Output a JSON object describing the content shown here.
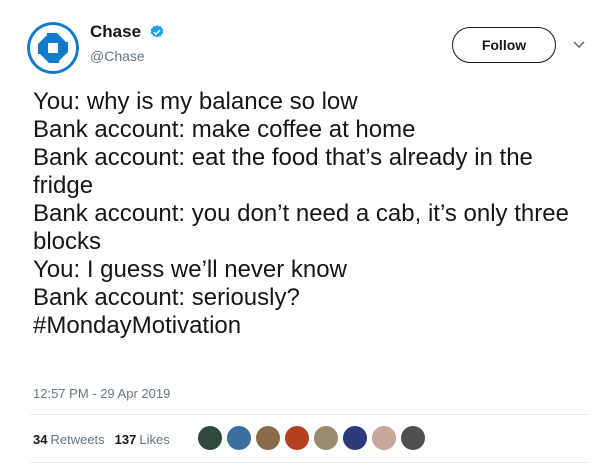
{
  "author": {
    "name": "Chase",
    "handle": "@Chase",
    "verified": true,
    "avatar_icon": "chase-octagon-logo",
    "brand_color": "#117aca"
  },
  "follow_button_label": "Follow",
  "more_menu_icon": "chevron-down-icon",
  "tweet_lines": [
    "You: why is my balance so low",
    "Bank account: make coffee at home",
    "Bank account: eat the food that’s already in the fridge",
    "Bank account: you don’t need a cab, it’s only three blocks",
    "You: I guess we’ll never know",
    "Bank account: seriously?",
    "#MondayMotivation"
  ],
  "timestamp": "12:57 PM - 29 Apr 2019",
  "retweets": {
    "count": "34",
    "label": "Retweets"
  },
  "likes": {
    "count": "137",
    "label": "Likes"
  },
  "liker_avatars": [
    {
      "color": "#2f4a3a"
    },
    {
      "color": "#3b6f9e"
    },
    {
      "color": "#8a6a4a"
    },
    {
      "color": "#b34020"
    },
    {
      "color": "#9a8a70"
    },
    {
      "color": "#2a3a7a"
    },
    {
      "color": "#c9a59a"
    },
    {
      "color": "#505050"
    }
  ]
}
